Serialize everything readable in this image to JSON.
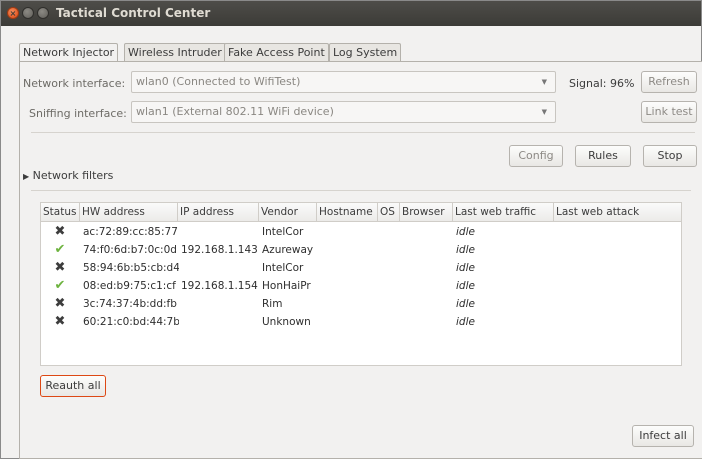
{
  "window": {
    "title": "Tactical Control Center"
  },
  "tabs": [
    {
      "label": "Network Injector",
      "active": true
    },
    {
      "label": "Wireless Intruder",
      "active": false
    },
    {
      "label": "Fake Access Point",
      "active": false
    },
    {
      "label": "Log System",
      "active": false
    }
  ],
  "network_interface": {
    "label": "Network interface:",
    "value": "wlan0 (Connected to WifiTest)",
    "signal_label": "Signal: 96%",
    "refresh_label": "Refresh"
  },
  "sniffing_interface": {
    "label": "Sniffing interface:",
    "value": "wlan1 (External 802.11 WiFi device)",
    "link_test_label": "Link test"
  },
  "actions": {
    "config": "Config",
    "rules": "Rules",
    "stop": "Stop"
  },
  "filters": {
    "label": "Network filters"
  },
  "table": {
    "columns": [
      "Status",
      "HW address",
      "IP address",
      "Vendor",
      "Hostname",
      "OS",
      "Browser",
      "Last web traffic",
      "Last web attack"
    ],
    "rows": [
      {
        "status": "x",
        "hw": "ac:72:89:cc:85:77",
        "ip": "",
        "vendor": "IntelCor",
        "hostname": "",
        "os": "",
        "browser": "",
        "traffic": "idle",
        "attack": ""
      },
      {
        "status": "ok",
        "hw": "74:f0:6d:b7:0c:0d",
        "ip": "192.168.1.143",
        "vendor": "Azureway",
        "hostname": "",
        "os": "",
        "browser": "",
        "traffic": "idle",
        "attack": ""
      },
      {
        "status": "x",
        "hw": "58:94:6b:b5:cb:d4",
        "ip": "",
        "vendor": "IntelCor",
        "hostname": "",
        "os": "",
        "browser": "",
        "traffic": "idle",
        "attack": ""
      },
      {
        "status": "ok",
        "hw": "08:ed:b9:75:c1:cf",
        "ip": "192.168.1.154",
        "vendor": "HonHaiPr",
        "hostname": "",
        "os": "",
        "browser": "",
        "traffic": "idle",
        "attack": ""
      },
      {
        "status": "x",
        "hw": "3c:74:37:4b:dd:fb",
        "ip": "",
        "vendor": "Rim",
        "hostname": "",
        "os": "",
        "browser": "",
        "traffic": "idle",
        "attack": ""
      },
      {
        "status": "x",
        "hw": "60:21:c0:bd:44:7b",
        "ip": "",
        "vendor": "Unknown",
        "hostname": "",
        "os": "",
        "browser": "",
        "traffic": "idle",
        "attack": ""
      }
    ]
  },
  "buttons": {
    "reauth_all": "Reauth all",
    "infect_all": "Infect all"
  },
  "icons": {
    "ok": "check-icon",
    "x": "cross-icon",
    "ok_color": "#6db33f",
    "x_color": "#3d3d3d"
  },
  "colors": {
    "titlebar": "#3c3b37",
    "close_button": "#dd4814",
    "reauth_border": "#dd4814"
  }
}
